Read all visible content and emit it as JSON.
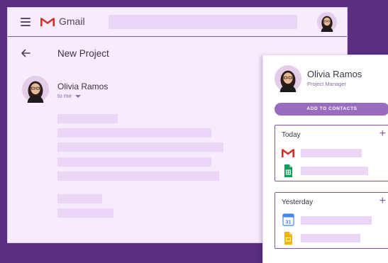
{
  "app": {
    "title": "Gmail"
  },
  "email": {
    "subject": "New Project",
    "sender_name": "Olivia Ramos",
    "recipient": "to me"
  },
  "contact_card": {
    "name": "Olivia Ramos",
    "role": "Project Manager",
    "add_button_label": "ADD TO CONTACTS",
    "sections": [
      {
        "title": "Today",
        "items": [
          {
            "icon": "gmail-icon"
          },
          {
            "icon": "google-sheets-icon"
          }
        ]
      },
      {
        "title": "Yesterday",
        "items": [
          {
            "icon": "google-calendar-icon",
            "icon_text": "31"
          },
          {
            "icon": "google-slides-icon"
          }
        ]
      }
    ]
  },
  "colors": {
    "background": "#5a2f82",
    "window": "#f7ecfd",
    "placeholder_bar": "#ebd6f8",
    "accent": "#9a6cc0",
    "section_border": "#8059a6"
  }
}
